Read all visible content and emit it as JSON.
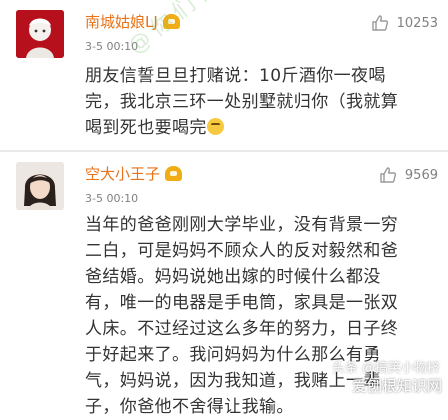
{
  "comments": [
    {
      "username": "南城姑娘LJ",
      "time": "3-5 00:10",
      "likes": "10253",
      "lines": [
        "朋友信誓旦旦打赌说：10斤酒你一夜喝",
        "完，我北京三环一处别墅就归你（我就算",
        "喝到死也要喝完"
      ],
      "emoji": "smile-emoji"
    },
    {
      "username": "空大小王子",
      "time": "3-5 00:10",
      "likes": "9569",
      "lines": [
        "当年的爸爸刚刚大学毕业，没有背景一穷",
        "二白，可是妈妈不顾众人的反对毅然和爸",
        "爸结婚。妈妈说她出嫁的时候什么都没",
        "有，唯一的电器是手电筒，家具是一张双",
        "人床。不过经过这么多年的努力，日子终",
        "于好起来了。我问妈妈为什么那么有勇",
        "气，妈妈说，因为我知道，我赌上一辈",
        "子，你爸他不舍得让我输。"
      ]
    }
  ],
  "watermark": {
    "diagonal": "@你们博物馆 排行榜",
    "site": "爱刨根知识网",
    "source": "头条 @搞笑小物挤"
  },
  "colors": {
    "username": "#e8731a",
    "body": "#333333",
    "meta": "#808080"
  }
}
